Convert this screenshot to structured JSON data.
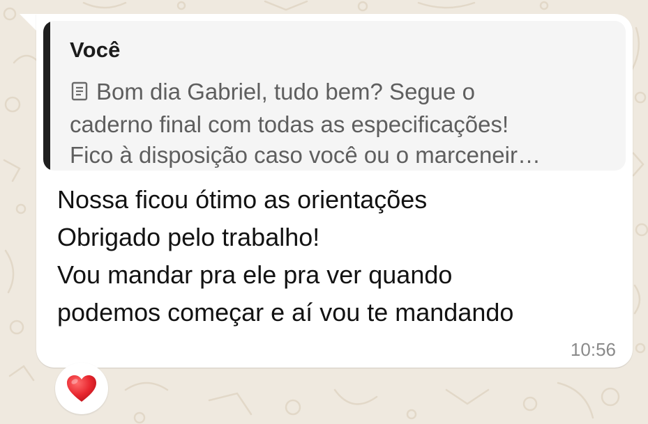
{
  "quoted_message": {
    "author": "Você",
    "icon": "document-icon",
    "text": "Bom dia Gabriel, tudo bem? Segue o\ncaderno final com todas as especificações!\nFico à disposição caso você ou o marceneir…"
  },
  "message": {
    "text": "Nossa ficou ótimo as orientações\nObrigado pelo trabalho!\nVou mandar pra ele pra ver quando\npodemos começar e aí vou te mandando",
    "time": "10:56"
  },
  "reaction": {
    "emoji": "heart-icon",
    "color": "#e8272f"
  },
  "colors": {
    "background": "#efe9df",
    "bubble": "#ffffff",
    "quote_background": "#f5f5f5",
    "quote_bar": "#1f1f1f"
  }
}
